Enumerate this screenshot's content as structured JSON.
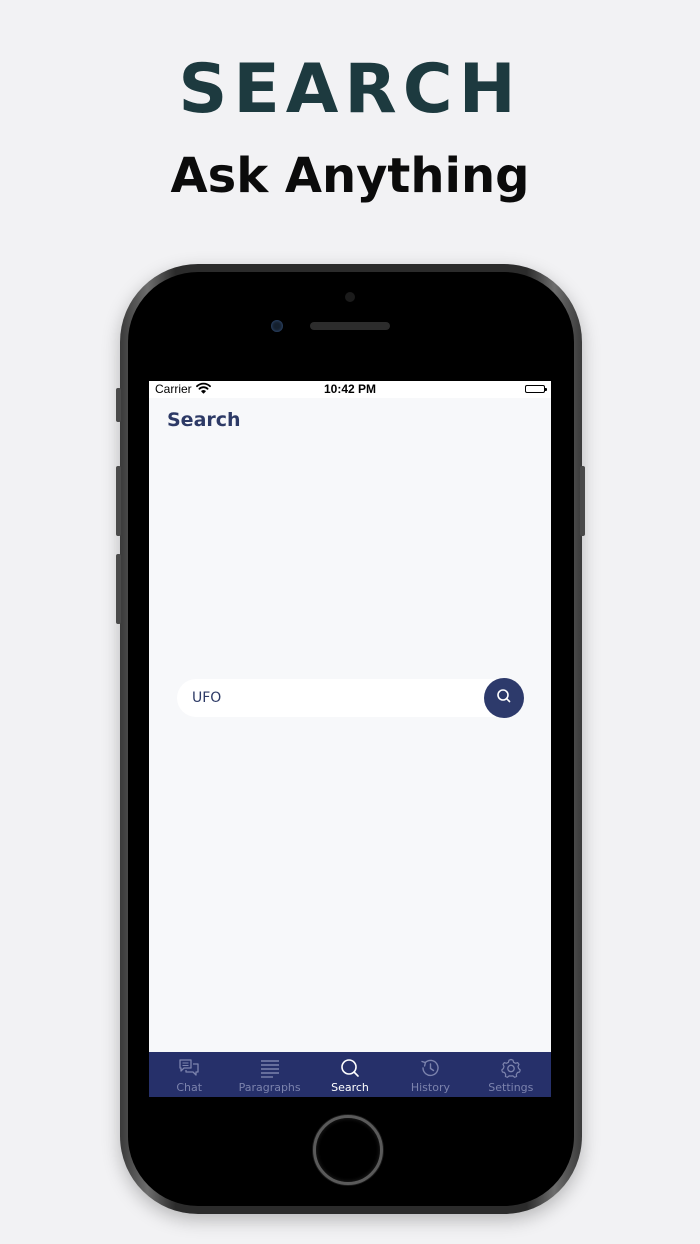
{
  "promo": {
    "headline": "SEARCH",
    "subheadline": "Ask Anything"
  },
  "status_bar": {
    "carrier": "Carrier",
    "time": "10:42 PM"
  },
  "screen": {
    "title": "Search",
    "search": {
      "value": "UFO",
      "placeholder": ""
    }
  },
  "tab_bar": {
    "tabs": [
      {
        "label": "Chat",
        "icon": "chat-icon",
        "active": false
      },
      {
        "label": "Paragraphs",
        "icon": "paragraphs-icon",
        "active": false
      },
      {
        "label": "Search",
        "icon": "search-icon",
        "active": true
      },
      {
        "label": "History",
        "icon": "history-icon",
        "active": false
      },
      {
        "label": "Settings",
        "icon": "settings-icon",
        "active": false
      }
    ]
  },
  "colors": {
    "primary": "#2d3a6b",
    "tab_bar_bg": "#26306a",
    "headline": "#1d3a3f",
    "screen_bg": "#f7f8fa"
  }
}
